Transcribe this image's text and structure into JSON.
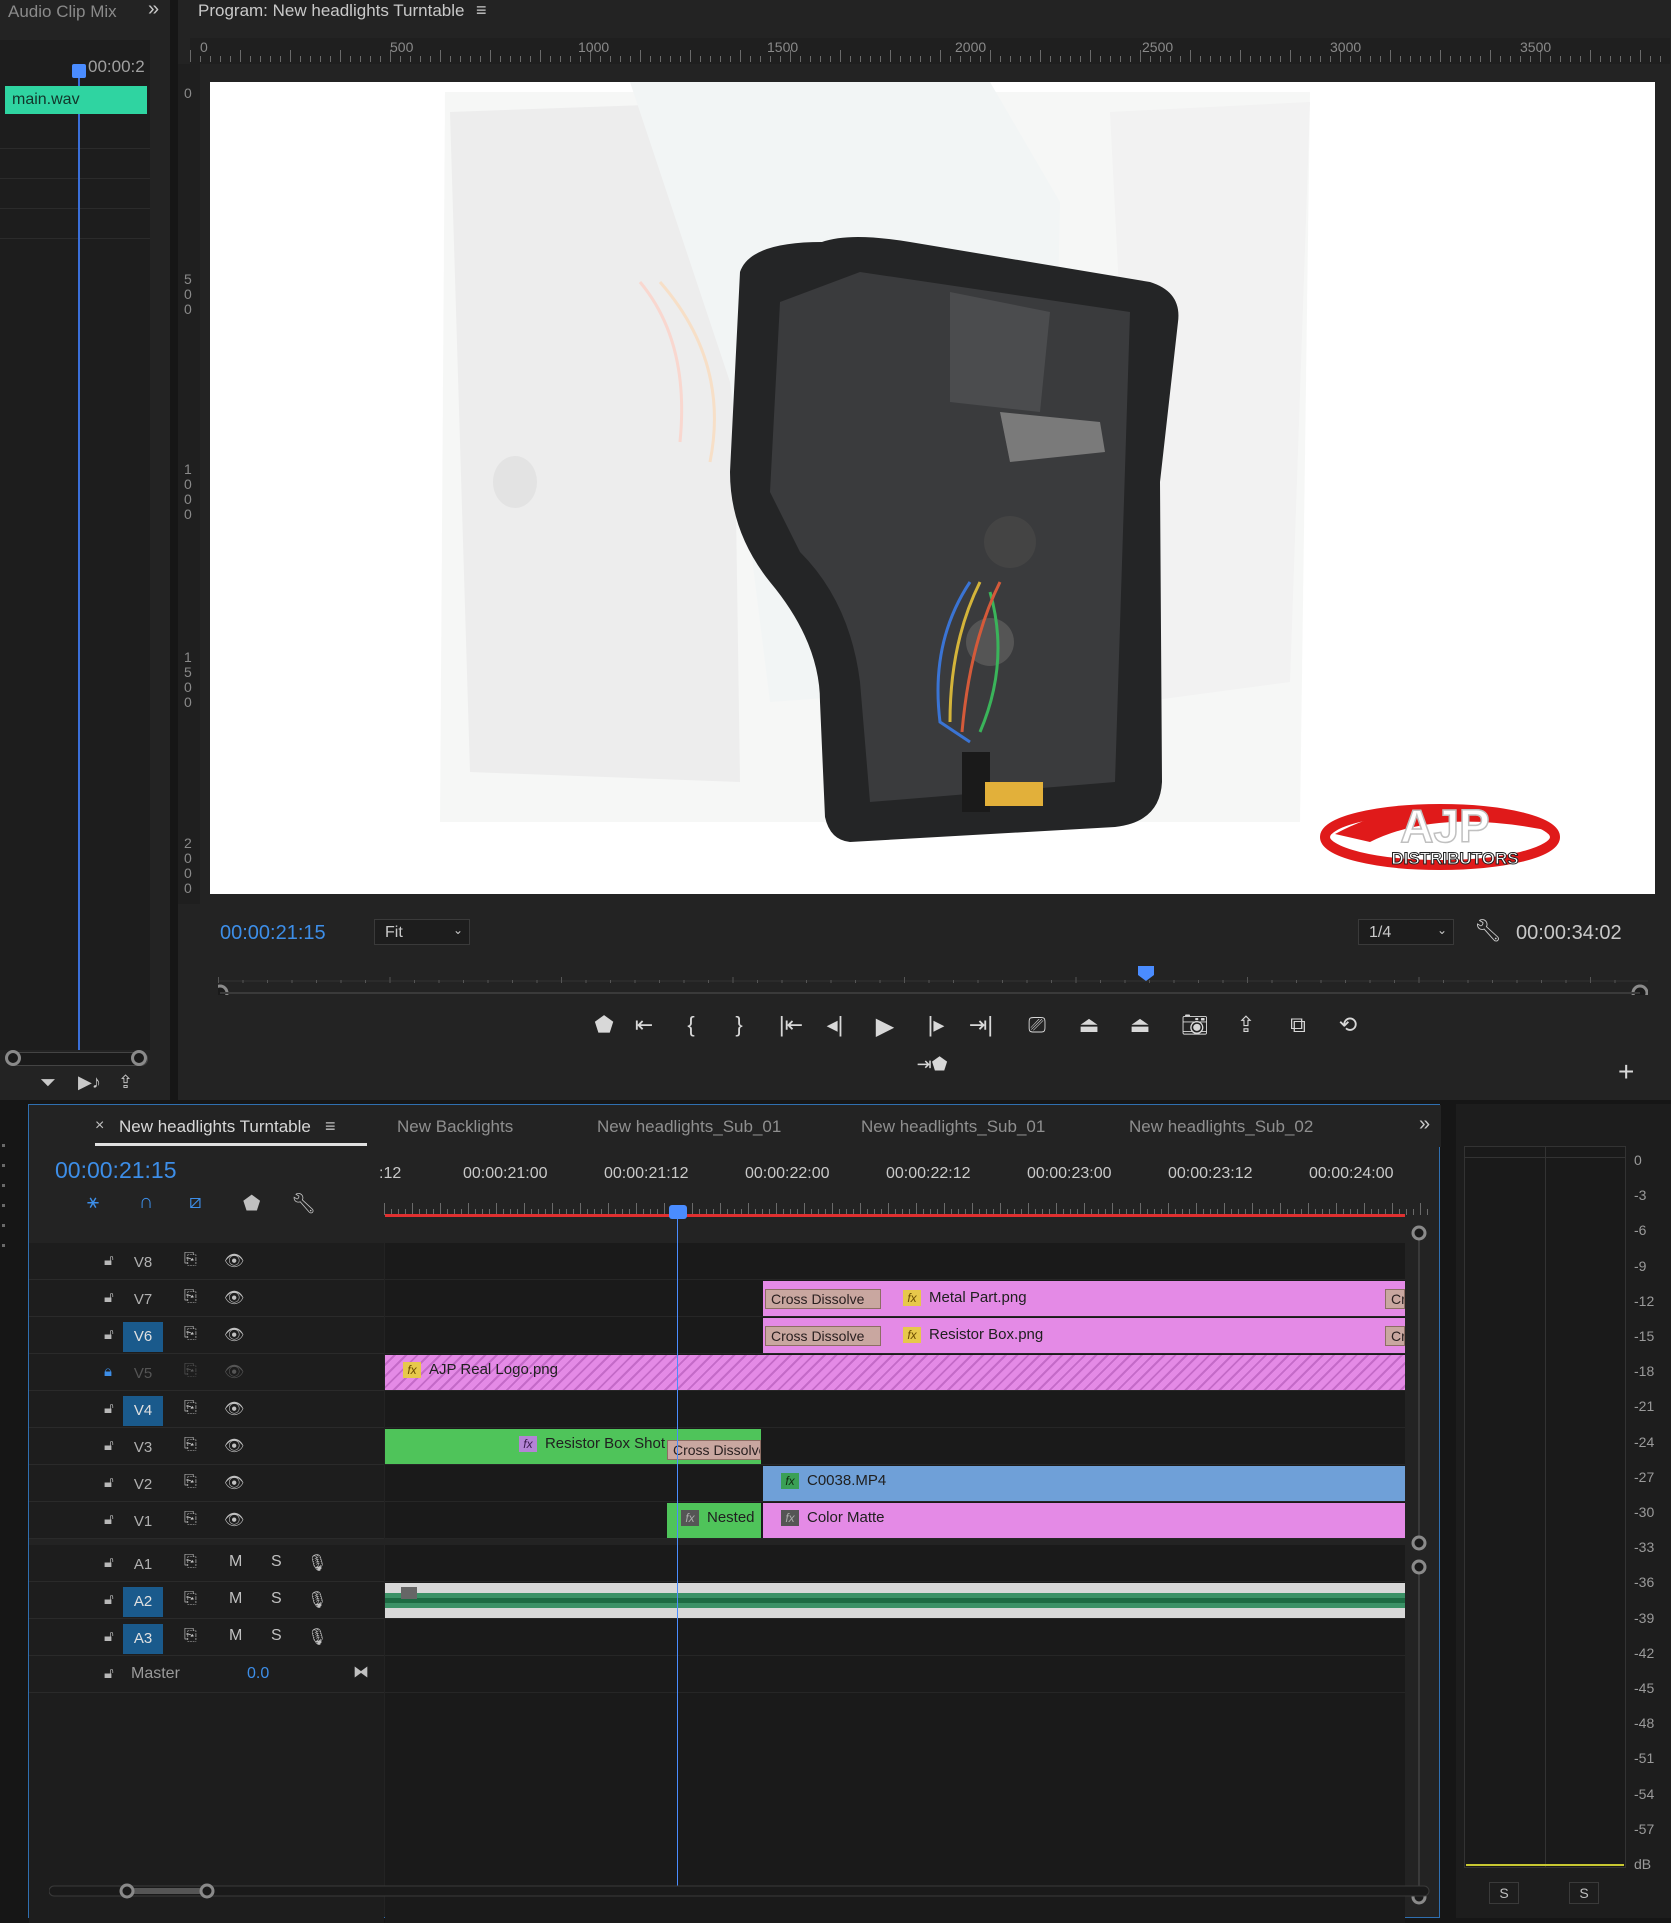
{
  "audio_clip_mixer": {
    "title": "Audio Clip Mix",
    "time": "00:00:2",
    "clip": "main.wav"
  },
  "program": {
    "title": "Program: New headlights Turntable",
    "ruler_top": [
      "0",
      "500",
      "1000",
      "1500",
      "2000",
      "2500",
      "3000",
      "3500"
    ],
    "ruler_left": [
      "0",
      "500",
      "1000",
      "1500",
      "2000"
    ],
    "timecode": "00:00:21:15",
    "zoom": "Fit",
    "resolution": "1/4",
    "duration": "00:00:34:02",
    "logo_top": "AJP",
    "logo_bottom": "DISTRIBUTORS"
  },
  "sequence": {
    "tabs": [
      "New headlights Turntable",
      "New Backlights",
      "New headlights_Sub_01",
      "New headlights_Sub_01",
      "New headlights_Sub_02"
    ],
    "timecode": "00:00:21:15",
    "ruler": [
      ":12",
      "00:00:21:00",
      "00:00:21:12",
      "00:00:22:00",
      "00:00:22:12",
      "00:00:23:00",
      "00:00:23:12",
      "00:00:24:00"
    ],
    "tracks": [
      {
        "name": "V8"
      },
      {
        "name": "V7"
      },
      {
        "name": "V6"
      },
      {
        "name": "V5"
      },
      {
        "name": "V4"
      },
      {
        "name": "V3"
      },
      {
        "name": "V2"
      },
      {
        "name": "V1"
      },
      {
        "name": "A1"
      },
      {
        "name": "A2"
      },
      {
        "name": "A3"
      }
    ],
    "audio_buttons": {
      "m": "M",
      "s": "S"
    },
    "master": {
      "label": "Master",
      "value": "0.0"
    },
    "clips": {
      "v7_trans": "Cross Dissolve",
      "v7_clip": "Metal Part.png",
      "v7_tail": "Cr",
      "v6_trans": "Cross Dissolve",
      "v6_clip": "Resistor Box.png",
      "v6_tail": "Cr",
      "v5_clip": "AJP Real Logo.png",
      "v3_clip": "Resistor Box Shot",
      "v3_trans": "Cross Dissolve",
      "v2_clip": "C0038.MP4",
      "v1_nested": "Nested",
      "v1_clip": "Color Matte"
    },
    "fx_label": "fx"
  },
  "meter": {
    "scale": [
      "0",
      "-3",
      "-6",
      "-9",
      "-12",
      "-15",
      "-18",
      "-21",
      "-24",
      "-27",
      "-30",
      "-33",
      "-36",
      "-39",
      "-42",
      "-45",
      "-48",
      "-51",
      "-54",
      "-57",
      "dB"
    ],
    "solo": [
      "S",
      "S"
    ]
  }
}
